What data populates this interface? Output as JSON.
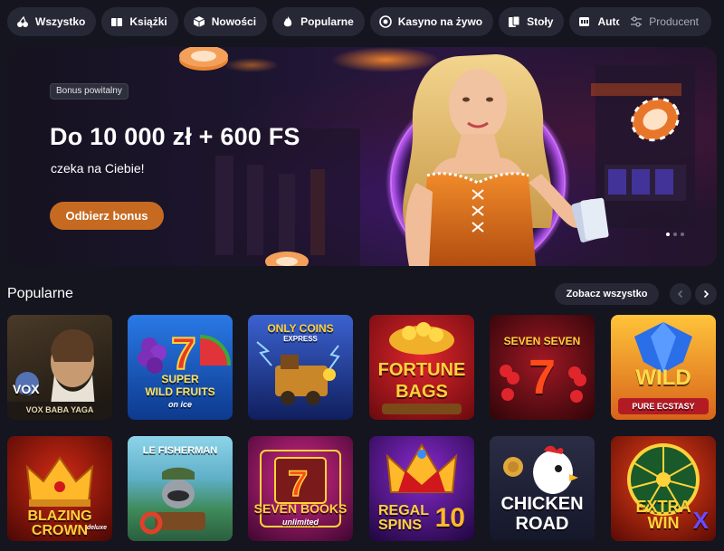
{
  "nav": {
    "items": [
      {
        "label": "Wszystko",
        "icon": "cherries-icon"
      },
      {
        "label": "Książki",
        "icon": "book-icon"
      },
      {
        "label": "Nowości",
        "icon": "cube-icon"
      },
      {
        "label": "Popularne",
        "icon": "flame-icon"
      },
      {
        "label": "Kasyno na żywo",
        "icon": "chip-icon"
      },
      {
        "label": "Stoły",
        "icon": "cards-icon"
      },
      {
        "label": "Automaty",
        "icon": "slot-icon"
      }
    ],
    "more_label": "···",
    "producer_label": "Producent"
  },
  "banner": {
    "tag": "Bonus powitalny",
    "headline": "Do 10 000 zł + 600 FS",
    "subline": "czeka na Ciebie!",
    "cta": "Odbierz bonus",
    "active_slide": 1,
    "slides": 3
  },
  "section": {
    "title": "Popularne",
    "see_all": "Zobacz wszystko"
  },
  "games": [
    {
      "name": "Vox Baba Yaga",
      "text1": "VOX",
      "text2": "VOX BABA YAGA",
      "colors": [
        "#3b2b1f",
        "#1f1a17"
      ]
    },
    {
      "name": "Super Wild Fruits On Ice",
      "text1": "SUPER",
      "text2": "WILD FRUITS",
      "text3": "on ice",
      "colors": [
        "#1f5fc4",
        "#0f3a8a"
      ]
    },
    {
      "name": "Only Coins Express",
      "text1": "ONLY COINS",
      "text2": "EXPRESS",
      "colors": [
        "#2f52b8",
        "#142a6e"
      ]
    },
    {
      "name": "Fortune Bags",
      "text1": "FORTUNE",
      "text2": "BAGS",
      "colors": [
        "#c1181d",
        "#6b0b10"
      ]
    },
    {
      "name": "Seven Seven",
      "text1": "SEVEN SEVEN",
      "text2": "7",
      "colors": [
        "#8a1520",
        "#3a070c"
      ]
    },
    {
      "name": "Wild Pure Ecstasy",
      "text1": "WILD",
      "text2": "PURE ECSTASY",
      "colors": [
        "#f3a21c",
        "#c25a12"
      ]
    },
    {
      "name": "Blazing Crown",
      "text1": "BLAZING",
      "text2": "CROWN",
      "text3": "deluxe",
      "colors": [
        "#c21a10",
        "#5b0705"
      ]
    },
    {
      "name": "Le Fisherman",
      "text1": "LE FISHERMAN",
      "colors": [
        "#5fb0c8",
        "#2d7a5a"
      ]
    },
    {
      "name": "Seven Books Unlimited",
      "text1": "SEVEN BOOKS",
      "text2": "unlimited",
      "colors": [
        "#b8166f",
        "#4a0b3b"
      ]
    },
    {
      "name": "Regal Spins 10",
      "text1": "REGAL",
      "text2": "SPINS",
      "text3": "10",
      "colors": [
        "#6a1fb0",
        "#2a0b55"
      ]
    },
    {
      "name": "Chicken Road",
      "text1": "CHICKEN",
      "text2": "ROAD",
      "colors": [
        "#2a2d44",
        "#15172a"
      ]
    },
    {
      "name": "Extra Win X",
      "text1": "EXTRA",
      "text2": "WIN",
      "text3": "X",
      "colors": [
        "#d12a10",
        "#6a0e05"
      ]
    }
  ]
}
